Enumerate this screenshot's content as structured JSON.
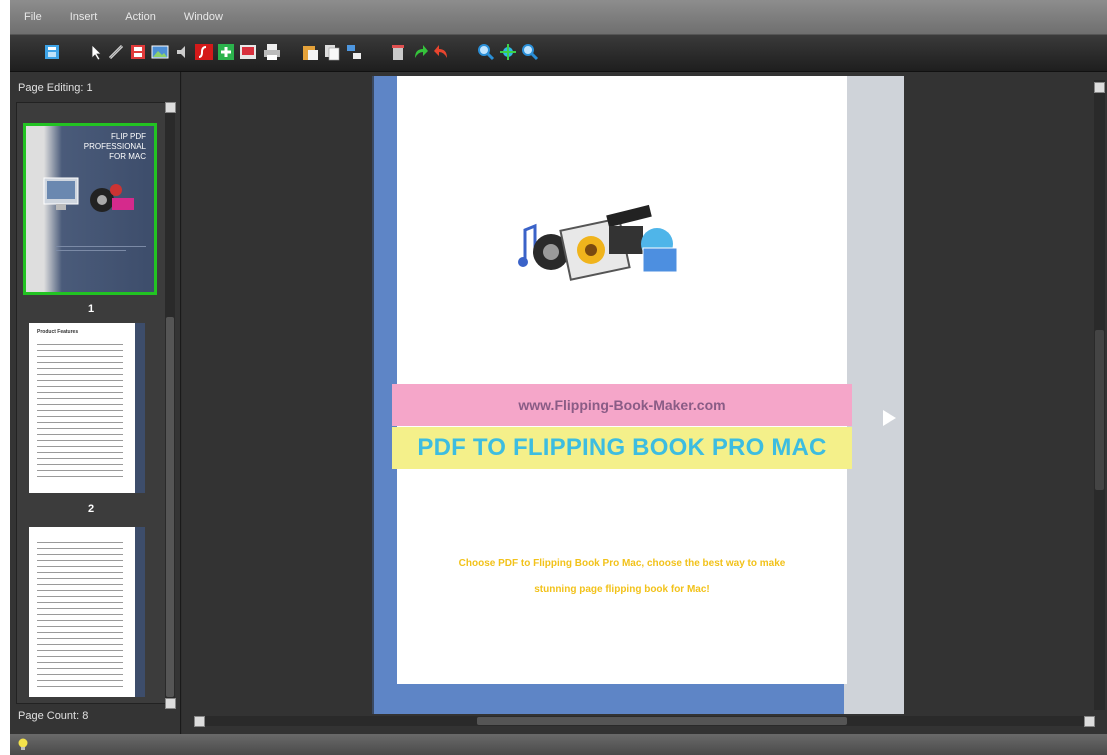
{
  "menubar": {
    "items": [
      "File",
      "Insert",
      "Action",
      "Window"
    ]
  },
  "toolbar": {
    "icons": [
      "book-icon",
      "pointer-icon",
      "link-icon",
      "film-strip-icon",
      "image-icon",
      "speaker-icon",
      "flash-icon",
      "add-page-icon",
      "slideshow-icon",
      "print-icon",
      "paste-icon",
      "copy-icon",
      "arrange-icon",
      "trash-icon",
      "redo-icon",
      "undo-icon",
      "zoom-in-icon",
      "fit-icon",
      "zoom-out-icon"
    ]
  },
  "left_panel": {
    "page_editing_label": "Page Editing: 1",
    "page_count_label": "Page Count: 8",
    "thumbnails": [
      {
        "number": "1",
        "title_line1": "FLIP PDF",
        "title_line2": "PROFESSIONAL",
        "title_line3": "FOR MAC"
      },
      {
        "number": "2",
        "heading": "Product Features"
      },
      {
        "number": "",
        "heading": ""
      }
    ]
  },
  "page": {
    "url_band": "www.Flipping-Book-Maker.com",
    "title_band": "PDF TO FLIPPING BOOK PRO MAC",
    "tagline_line1": "Choose PDF to Flipping Book Pro Mac, choose the best way to make",
    "tagline_line2": "stunning page flipping book for Mac!"
  },
  "colors": {
    "accent_green": "#22c322",
    "book_blue": "#5e85c6",
    "pink_band": "#f5a6c9",
    "yellow_band": "#f4f08a",
    "title_text": "#3dbde0",
    "tagline_text": "#f2c21a"
  }
}
